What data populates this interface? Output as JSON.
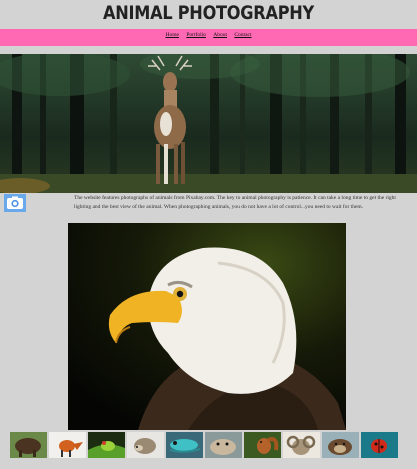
{
  "site": {
    "title": "ANIMAL PHOTOGRAPHY"
  },
  "nav": {
    "items": [
      "Home",
      "Portfolio",
      "About",
      "Contact"
    ]
  },
  "intro": {
    "text": "The website features photographs of animals from Pixabay.com. The key to animal photography is patience. It can take a long time to get the right lighting and the best view of the animal. When photographing animals, you do not have a lot of control...you need to wait for them."
  },
  "hero": {
    "subject": "deer-in-forest"
  },
  "feature": {
    "subject": "bald-eagle-portrait"
  },
  "gallery": {
    "thumbnails": [
      "bison",
      "fox",
      "frog",
      "hedgehog",
      "lizard",
      "seal",
      "squirrel",
      "ram",
      "otter",
      "ladybug"
    ]
  },
  "colors": {
    "nav_bar": "#ff69b4",
    "page_background": "#d3d3d3",
    "camera_icon": "#4a90e2"
  }
}
